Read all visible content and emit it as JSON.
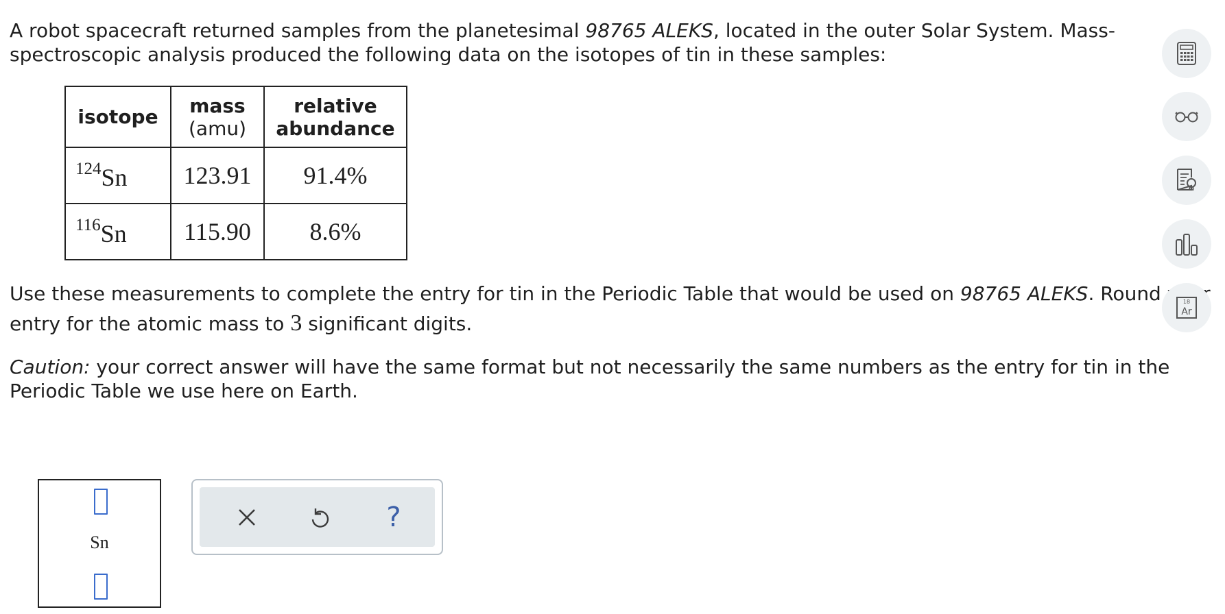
{
  "intro": {
    "part1": "A robot spacecraft returned samples from the planetesimal ",
    "planet": "98765 ALEKS",
    "part2": ", located in the outer Solar System. Mass-spectroscopic analysis produced the following data on the isotopes of tin in these samples:"
  },
  "table": {
    "headers": {
      "isotope": "isotope",
      "mass": "mass",
      "mass_unit": "(amu)",
      "abundance_line1": "relative",
      "abundance_line2": "abundance"
    },
    "rows": [
      {
        "mass_number": "124",
        "symbol": "Sn",
        "mass": "123.91",
        "abundance": "91.4%"
      },
      {
        "mass_number": "116",
        "symbol": "Sn",
        "mass": "115.90",
        "abundance": "8.6%"
      }
    ]
  },
  "instructions": {
    "part1": "Use these measurements to complete the entry for tin in the Periodic Table that would be used on ",
    "planet": "98765 ALEKS",
    "part2": ". Round your entry for the atomic mass to ",
    "digits": "3",
    "part3": " significant digits."
  },
  "caution": {
    "label": "Caution:",
    "text": " your correct answer will have the same format but not necessarily the same numbers as the entry for tin in the Periodic Table we use here on Earth."
  },
  "element_tile": {
    "symbol": "Sn",
    "atomic_number_value": "",
    "atomic_mass_value": ""
  },
  "actions": {
    "clear_icon": "close-icon",
    "undo_icon": "undo-icon",
    "help_label": "?"
  },
  "sidebar": {
    "icons": [
      "calculator-icon",
      "reader-glasses-icon",
      "hint-icon",
      "data-chart-icon",
      "periodic-table-icon"
    ],
    "periodic_table_number": "18",
    "periodic_table_symbol": "Ar"
  },
  "colors": {
    "input_border": "#3a6ccc",
    "sidebar_bg": "#eef1f3",
    "action_bg": "#e3e8eb"
  }
}
